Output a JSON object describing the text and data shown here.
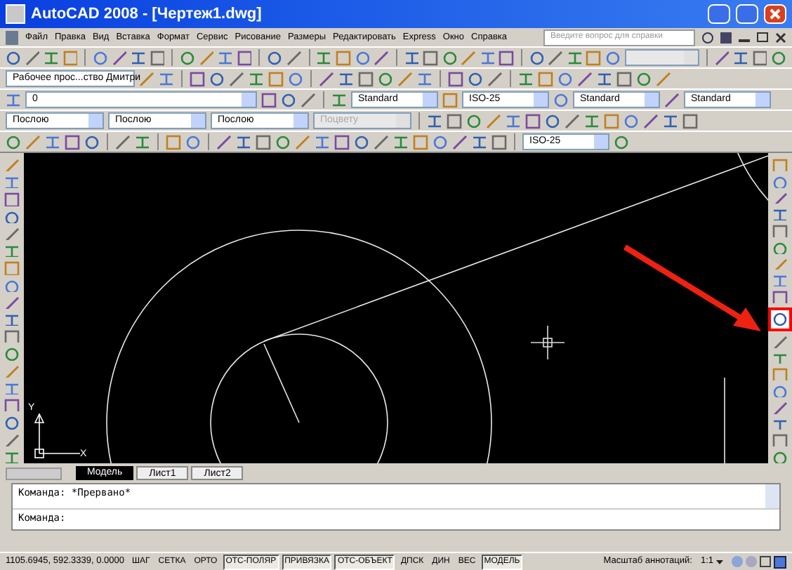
{
  "window": {
    "title": "AutoCAD 2008 - [Чертеж1.dwg]"
  },
  "menu": [
    "Файл",
    "Правка",
    "Вид",
    "Вставка",
    "Формат",
    "Сервис",
    "Рисование",
    "Размеры",
    "Редактировать",
    "Express",
    "Окно",
    "Справка"
  ],
  "help_search": {
    "placeholder": "Введите вопрос для справки"
  },
  "workspace": {
    "value": "Рабочее прос...ство Дмитри"
  },
  "layer": {
    "value": "0"
  },
  "styles": [
    {
      "value": "Standard"
    },
    {
      "value": "ISO-25"
    },
    {
      "value": "Standard"
    },
    {
      "value": "Standard"
    }
  ],
  "properties": [
    {
      "value": "Послою",
      "disabled": false
    },
    {
      "value": "Послою",
      "disabled": false
    },
    {
      "value": "Послою",
      "disabled": false
    },
    {
      "value": "Поцвету",
      "disabled": true
    }
  ],
  "dim_style": {
    "value": "ISO-25"
  },
  "tabs": [
    {
      "label": "Модель",
      "selected": true
    },
    {
      "label": "Лист1",
      "selected": false
    },
    {
      "label": "Лист2",
      "selected": false
    }
  ],
  "command_lines": [
    "Команда: *Прервано*",
    "Команда:"
  ],
  "status_bar": {
    "coordinates": "1105.6945, 592.3339, 0.0000",
    "toggles": [
      {
        "label": "ШАГ",
        "on": false
      },
      {
        "label": "СЕТКА",
        "on": false
      },
      {
        "label": "ОРТО",
        "on": false
      },
      {
        "label": "ОТС-ПОЛЯР",
        "on": true
      },
      {
        "label": "ПРИВЯЗКА",
        "on": true
      },
      {
        "label": "ОТС-ОБЪЕКТ",
        "on": true
      },
      {
        "label": "ДПСК",
        "on": false
      },
      {
        "label": "ДИН",
        "on": false
      },
      {
        "label": "ВЕС",
        "on": false
      },
      {
        "label": "МОДЕЛЬ",
        "on": true
      }
    ],
    "annotation_scale_label": "Масштаб аннотаций:",
    "annotation_scale": "1:1"
  },
  "ucs": {
    "x_label": "X",
    "y_label": "Y"
  }
}
